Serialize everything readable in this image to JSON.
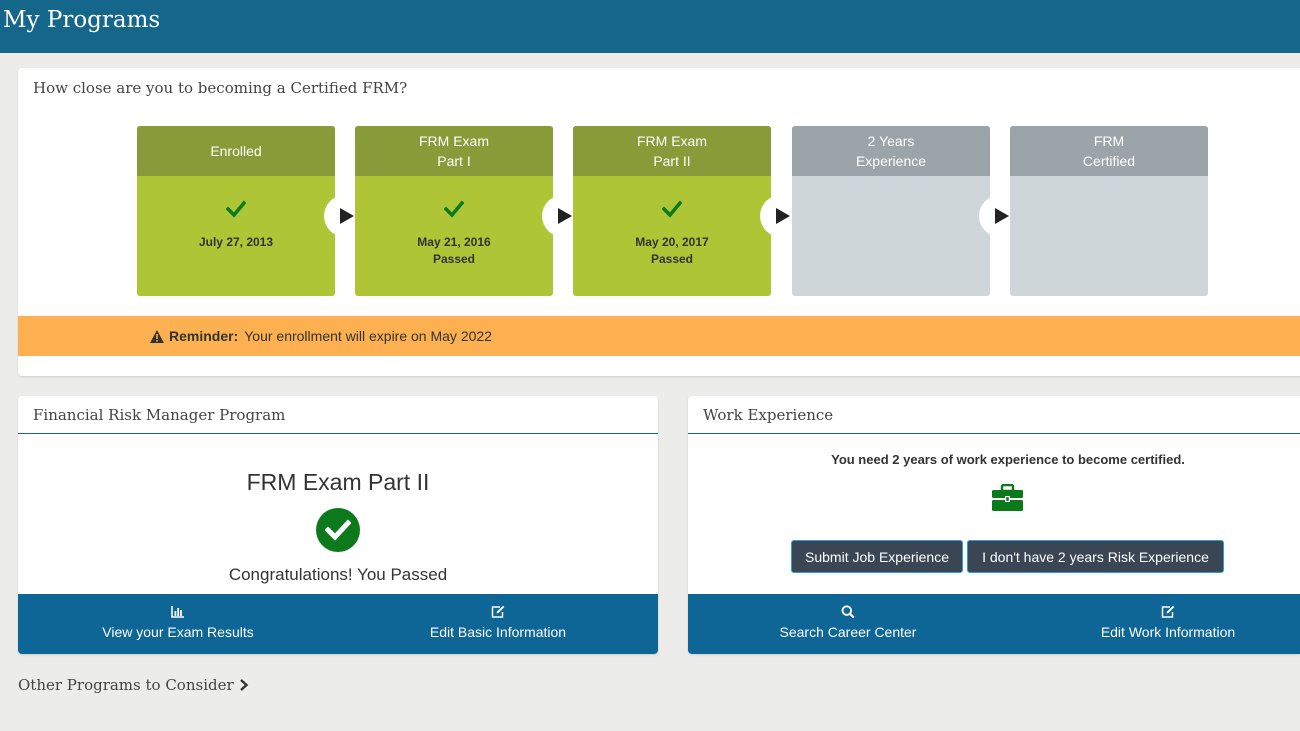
{
  "header": {
    "title": "My Programs"
  },
  "progress": {
    "heading": "How close are you to becoming a Certified FRM?",
    "steps": [
      {
        "line1": "",
        "line2": "Enrolled",
        "date": "July 27, 2013",
        "status": "",
        "done": true
      },
      {
        "line1": "FRM Exam",
        "line2": "Part I",
        "date": "May 21, 2016",
        "status": "Passed",
        "done": true
      },
      {
        "line1": "FRM Exam",
        "line2": "Part II",
        "date": "May 20, 2017",
        "status": "Passed",
        "done": true
      },
      {
        "line1": "2 Years",
        "line2": "Experience",
        "date": "",
        "status": "",
        "done": false
      },
      {
        "line1": "FRM",
        "line2": "Certified",
        "date": "",
        "status": "",
        "done": false
      }
    ],
    "reminder": {
      "label": "Reminder:",
      "text": "Your enrollment will expire on May 2022"
    }
  },
  "program": {
    "heading": "Financial Risk Manager Program",
    "title": "FRM Exam Part II",
    "message": "Congratulations! You Passed",
    "actions": {
      "results": "View your Exam Results",
      "edit_basic": "Edit Basic Information"
    }
  },
  "work": {
    "heading": "Work Experience",
    "need_text": "You need 2 years of work experience to become certified.",
    "submit_label": "Submit Job Experience",
    "no_exp_label": "I don't have 2 years Risk Experience",
    "actions": {
      "search": "Search Career Center",
      "edit_work": "Edit Work Information"
    }
  },
  "other_programs": "Other Programs to Consider",
  "colors": {
    "header": "#14668b",
    "step_done": "#aec636",
    "step_done_head": "#889b38",
    "step_pending": "#cfd6d9",
    "step_pending_head": "#9ba4a8",
    "reminder": "#fdb04f",
    "action_bar": "#0d6696",
    "success": "#0c7a1c"
  },
  "icons": [
    "check-icon",
    "play-arrow-icon",
    "warning-icon",
    "check-circle-icon",
    "bar-chart-icon",
    "edit-icon",
    "search-icon",
    "briefcase-icon",
    "chevron-right-icon"
  ]
}
